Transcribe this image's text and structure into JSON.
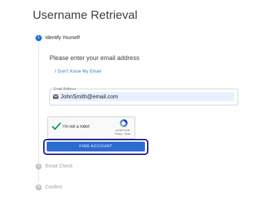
{
  "page": {
    "title": "Username Retrieval"
  },
  "steps": [
    {
      "number": "1",
      "label": "Identify Yourself",
      "state": "active"
    },
    {
      "number": "2",
      "label": "Email Check",
      "state": "inactive"
    },
    {
      "number": "3",
      "label": "Confirm",
      "state": "inactive"
    }
  ],
  "form": {
    "prompt": "Please enter your email address",
    "dont_know_link": "I Don't Know My Email",
    "email_label": "Email Address",
    "email_value": "JohnSmith@email.com"
  },
  "recaptcha": {
    "label": "I'm not a robot",
    "brand": "reCAPTCHA",
    "terms": "Privacy - Terms",
    "checked": true
  },
  "actions": {
    "find_account_label": "FIND ACCOUNT"
  },
  "colors": {
    "accent": "#1a6dd6",
    "button": "#2b6cd1",
    "highlight_frame": "#1f1d8a",
    "check": "#009e55"
  },
  "icons": {
    "email": "mail-icon",
    "recaptcha_check": "check-icon",
    "recaptcha_logo": "recaptcha-logo-icon"
  }
}
